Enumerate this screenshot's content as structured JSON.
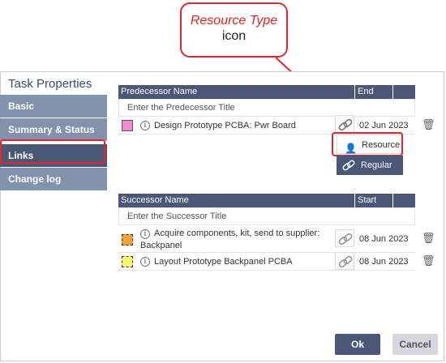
{
  "callout": {
    "line1": "Resource Type",
    "line2": "icon"
  },
  "dialog": {
    "title": "Task Properties"
  },
  "sidebar": {
    "items": [
      {
        "label": "Basic"
      },
      {
        "label": "Summary & Status"
      },
      {
        "label": "Links"
      },
      {
        "label": "Change log"
      }
    ]
  },
  "predecessor": {
    "header_name": "Predecessor Name",
    "header_date": "End date",
    "placeholder": "Enter the Predecessor Title",
    "rows": [
      {
        "name": "Design Prototype PCBA: Pwr Board",
        "date": "02 Jun 2023",
        "color": "#f28ad4"
      }
    ]
  },
  "link_type_menu": {
    "items": [
      {
        "label": "Resource",
        "icon": "person-icon"
      },
      {
        "label": "Regular",
        "icon": "link-icon"
      }
    ]
  },
  "successor": {
    "header_name": "Successor Name",
    "header_date": "Start date",
    "placeholder": "Enter the Successor Title",
    "rows": [
      {
        "name_line1": "Acquire components, kit, send to supplier:",
        "name_line2": "Backpanel",
        "date": "08 Jun 2023",
        "color": "#f4a340"
      },
      {
        "name": "Layout Prototype Backpanel PCBA",
        "date": "08 Jun 2023",
        "color": "#f7f56a"
      }
    ]
  },
  "buttons": {
    "ok": "Ok",
    "cancel": "Cancel"
  }
}
